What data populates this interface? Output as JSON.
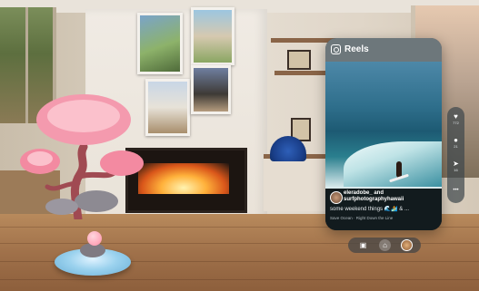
{
  "app": {
    "title": "Reels"
  },
  "post": {
    "author": "eleradobe_ and surfphotographyhawaii",
    "caption": "some weekend things 🌊🏄 & ...",
    "audio": "Save Ocean · Right Down the Line"
  },
  "actions": [
    {
      "icon": "heart-icon",
      "glyph": "♥",
      "count": "772"
    },
    {
      "icon": "comment-icon",
      "glyph": "●",
      "count": "21"
    },
    {
      "icon": "share-icon",
      "glyph": "➤",
      "count": "16"
    },
    {
      "icon": "more-icon",
      "glyph": "•••",
      "count": ""
    }
  ],
  "nav": [
    {
      "icon": "reels-icon",
      "glyph": "▣"
    },
    {
      "icon": "home-icon",
      "glyph": "⌂"
    },
    {
      "icon": "profile-avatar-icon",
      "glyph": ""
    }
  ],
  "colors": {
    "panel": "#0d1418",
    "accent_fire": "#ffb13b"
  }
}
